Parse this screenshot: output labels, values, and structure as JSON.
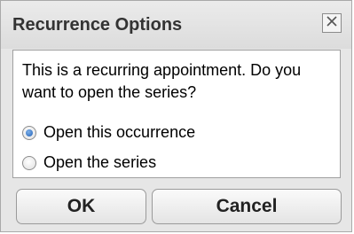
{
  "dialog": {
    "title": "Recurrence Options",
    "message": "This is a recurring appointment. Do you want to open the series?",
    "options": [
      {
        "label": "Open this occurrence",
        "selected": true
      },
      {
        "label": "Open the series",
        "selected": false
      }
    ],
    "buttons": {
      "ok": "OK",
      "cancel": "Cancel"
    },
    "icons": {
      "close": "close-icon"
    },
    "colors": {
      "radio_selected": "#2a6fcc",
      "titlebar": "#dedede"
    }
  }
}
